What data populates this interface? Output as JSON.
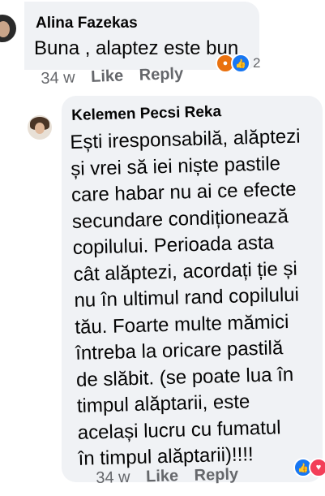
{
  "comments": [
    {
      "author": "Alina Fazekas",
      "text": "Buna , alaptez este bun",
      "time": "34 w",
      "like_label": "Like",
      "reply_label": "Reply",
      "reactions": {
        "icons": [
          "angry-icon",
          "like-icon"
        ],
        "count": "2"
      }
    },
    {
      "author": "Kelemen Pecsi Reka",
      "text_lines": [
        "Ești iresponsabilă, alăptezi",
        "și vrei să iei niște pastile",
        "care habar nu ai ce efecte",
        "secundare condiționează",
        "copilului. Perioada asta",
        "cât alăptezi, acordați ție și",
        "nu în ultimul rand copilului",
        "tău. Foarte multe mămici",
        "întreba la oricare pastilă",
        "de slăbit. (se poate lua în",
        "timpul alăptarii, este",
        "același lucru  cu  fumatul",
        "în timpul alăptarii)!!!!"
      ],
      "time": "34 w",
      "like_label": "Like",
      "reply_label": "Reply",
      "reactions": {
        "icons": [
          "like-icon",
          "love-icon"
        ]
      }
    }
  ],
  "colors": {
    "bubble": "#f0f2f5",
    "meta": "#65676b",
    "like": "#1877f2",
    "love": "#f33e58",
    "angry": "#e9710f"
  }
}
